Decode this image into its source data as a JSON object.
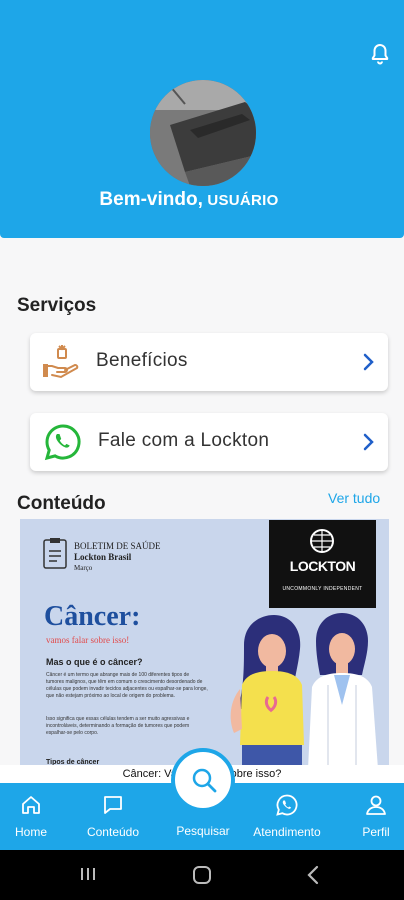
{
  "header": {
    "welcome_greeting": "Bem-vindo,",
    "welcome_user": "USUÁRIO"
  },
  "services": {
    "title": "Serviços",
    "items": [
      {
        "label": "Benefícios",
        "icon": "hand-gift-icon"
      },
      {
        "label": "Fale com a Lockton",
        "icon": "whatsapp-icon"
      }
    ]
  },
  "content": {
    "title": "Conteúdo",
    "see_all": "Ver tudo",
    "banner": {
      "bulletin_title": "BOLETIM DE SAÚDE",
      "bulletin_sub": "Lockton Brasil",
      "bulletin_date": "Março",
      "brand": "LOCKTON",
      "brand_tagline": "UNCOMMONLY INDEPENDENT",
      "headline": "Câncer:",
      "subheadline": "vamos falar sobre isso!",
      "question": "Mas o que é o câncer?",
      "para1": "Câncer é um termo que abrange mais de 100 diferentes tipos de tumores malignos, que têm em comum o crescimento desordenado de células que podem invadir tecidos adjacentes ou espalhar-se para longe, que não estejam próximo ao local de origem do problema.",
      "para2": "Isso significa que essas células tendem a ser muito agressivas e incontroláveis, determinando a formação de tumores que podem espalhar-se pelo corpo.",
      "types": "Tipos de câncer"
    },
    "caption": "Câncer: Vamos falar sobre isso?"
  },
  "tabbar": {
    "items": [
      {
        "label": "Home",
        "icon": "home-icon"
      },
      {
        "label": "Conteúdo",
        "icon": "chat-bubble-icon"
      },
      {
        "label": "Pesquisar",
        "icon": "search-icon"
      },
      {
        "label": "Atendimento",
        "icon": "whatsapp-icon"
      },
      {
        "label": "Perfil",
        "icon": "person-icon"
      }
    ]
  },
  "colors": {
    "primary": "#1ea6e8",
    "whatsapp": "#25b63a",
    "chevron": "#1f5fc9"
  }
}
